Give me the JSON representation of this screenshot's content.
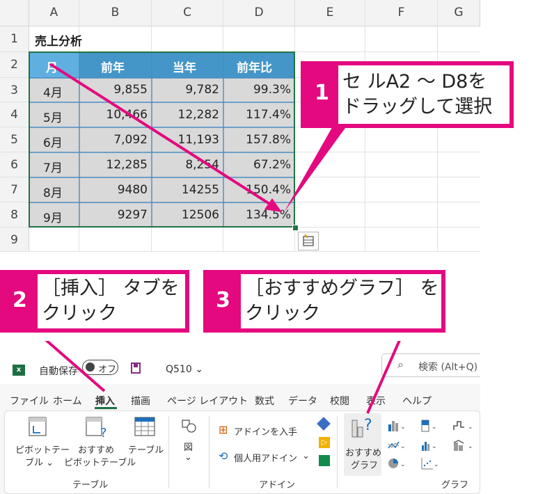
{
  "sheet": {
    "columns": [
      "A",
      "B",
      "C",
      "D",
      "E",
      "F",
      "G"
    ],
    "rows": [
      "1",
      "2",
      "3",
      "4",
      "5",
      "6",
      "7",
      "8",
      "9"
    ],
    "title": "売上分析",
    "headers": [
      "月",
      "前年",
      "当年",
      "前年比"
    ],
    "data": [
      [
        "4月",
        "9,855",
        "9,782",
        "99.3%"
      ],
      [
        "5月",
        "10,466",
        "12,282",
        "117.4%"
      ],
      [
        "6月",
        "7,092",
        "11,193",
        "157.8%"
      ],
      [
        "7月",
        "12,285",
        "8,254",
        "67.2%"
      ],
      [
        "8月",
        "9480",
        "14255",
        "150.4%"
      ],
      [
        "9月",
        "9297",
        "12506",
        "134.5%"
      ]
    ]
  },
  "callouts": {
    "c1": {
      "num": "1",
      "line1": "セ ルA2 ～ D8を",
      "line2": "ドラッグして選択"
    },
    "c2": {
      "num": "2",
      "line1": "［挿入］ タブを",
      "line2": "クリック"
    },
    "c3": {
      "num": "3",
      "line1": "［おすすめグラフ］ を",
      "line2": "クリック"
    }
  },
  "titlebar": {
    "autosave": "自動保存",
    "toggle": "オフ",
    "filename": "Q510 ⌄",
    "search_placeholder": "検索 (Alt+Q)"
  },
  "tabs": [
    "ファイル",
    "ホーム",
    "挿入",
    "描画",
    "ページ レイアウト",
    "数式",
    "データ",
    "校閲",
    "表示",
    "ヘルプ"
  ],
  "active_tab": "挿入",
  "ribbon": {
    "pivot_line1": "ピボットテー",
    "pivot_line2": "ブル ⌄",
    "recpivot_line1": "おすすめ",
    "recpivot_line2": "ピボットテーブル",
    "table": "テーブル",
    "figure": "図",
    "figure_caret": "⌄",
    "group_table": "テーブル",
    "get_addin": "アドインを入手",
    "my_addin": "個人用アドイン",
    "my_addin_caret": "⌄",
    "group_addin": "アドイン",
    "rec_chart_line1": "おすすめ",
    "rec_chart_line2": "グラフ",
    "group_chart": "グラフ"
  },
  "colors": {
    "accent": "#e4097f",
    "header_fill": "#4596c8",
    "header_fill_a": "#5fb0e0",
    "data_fill": "#d9d9d9",
    "selection": "#217346"
  }
}
